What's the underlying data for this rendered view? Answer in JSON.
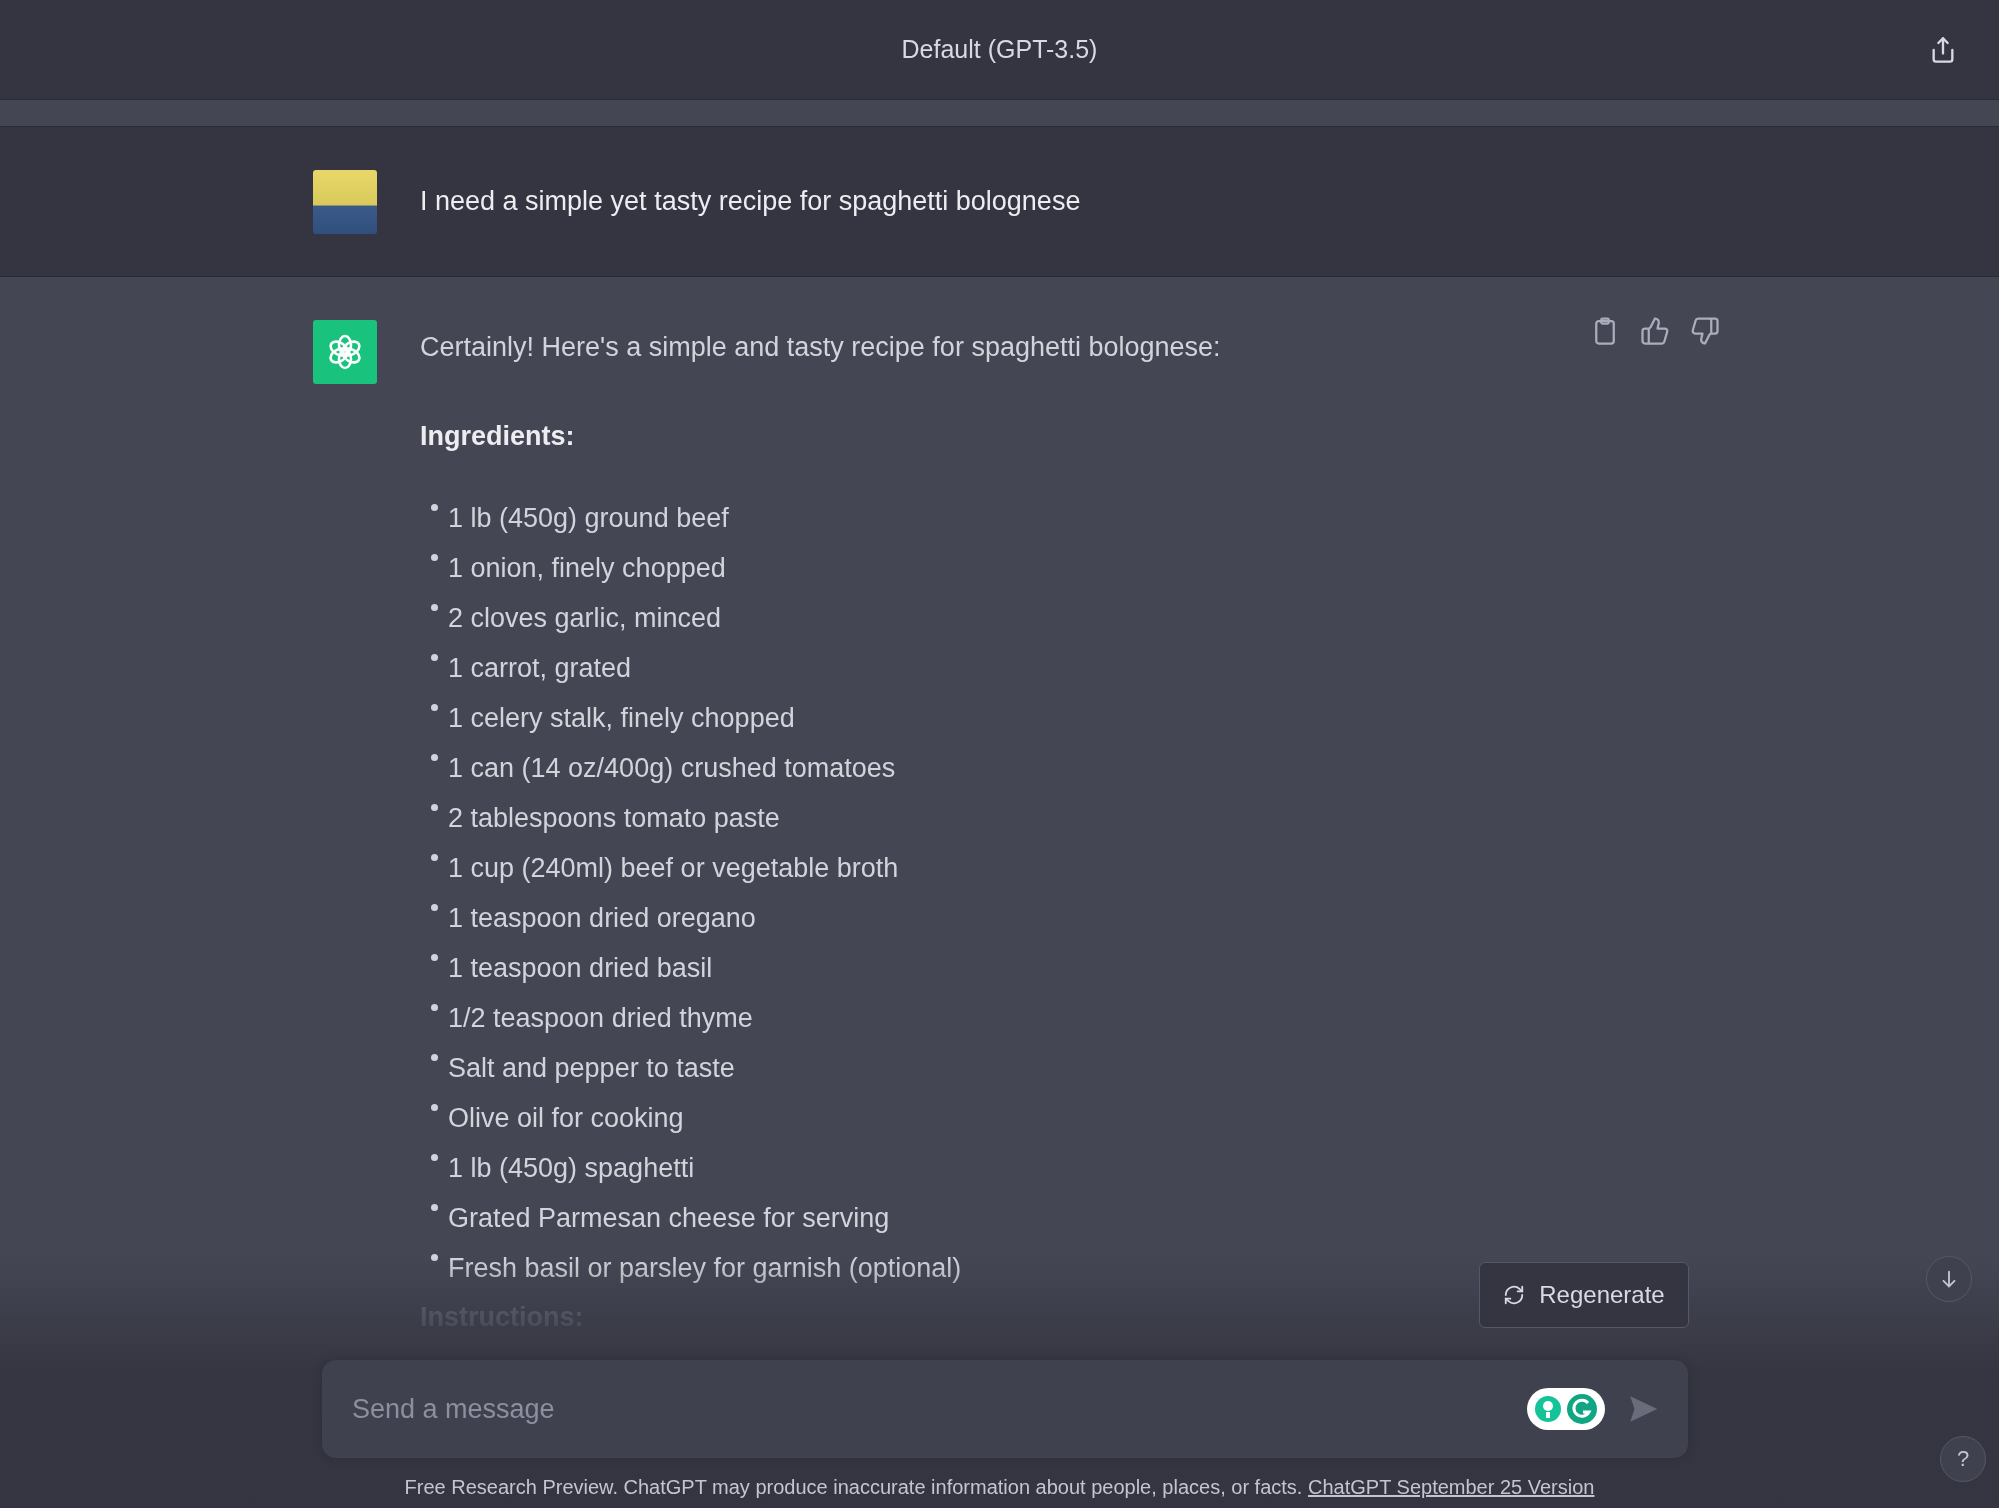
{
  "header": {
    "title": "Default (GPT-3.5)"
  },
  "user_message": {
    "text": "I need a simple yet tasty recipe for spaghetti bolognese"
  },
  "assistant_message": {
    "intro": "Certainly! Here's a simple and tasty recipe for spaghetti bolognese:",
    "ingredients_heading": "Ingredients:",
    "ingredients": [
      "1 lb (450g) ground beef",
      "1 onion, finely chopped",
      "2 cloves garlic, minced",
      "1 carrot, grated",
      "1 celery stalk, finely chopped",
      "1 can (14 oz/400g) crushed tomatoes",
      "2 tablespoons tomato paste",
      "1 cup (240ml) beef or vegetable broth",
      "1 teaspoon dried oregano",
      "1 teaspoon dried basil",
      "1/2 teaspoon dried thyme",
      "Salt and pepper to taste",
      "Olive oil for cooking",
      "1 lb (450g) spaghetti",
      "Grated Parmesan cheese for serving",
      "Fresh basil or parsley for garnish (optional)"
    ],
    "instructions_heading": "Instructions:"
  },
  "regenerate_button": {
    "label": "Regenerate"
  },
  "composer": {
    "placeholder": "Send a message"
  },
  "footer": {
    "text": "Free Research Preview. ChatGPT may produce inaccurate information about people, places, or facts.",
    "link": "ChatGPT September 25 Version"
  },
  "help_button": {
    "label": "?"
  }
}
